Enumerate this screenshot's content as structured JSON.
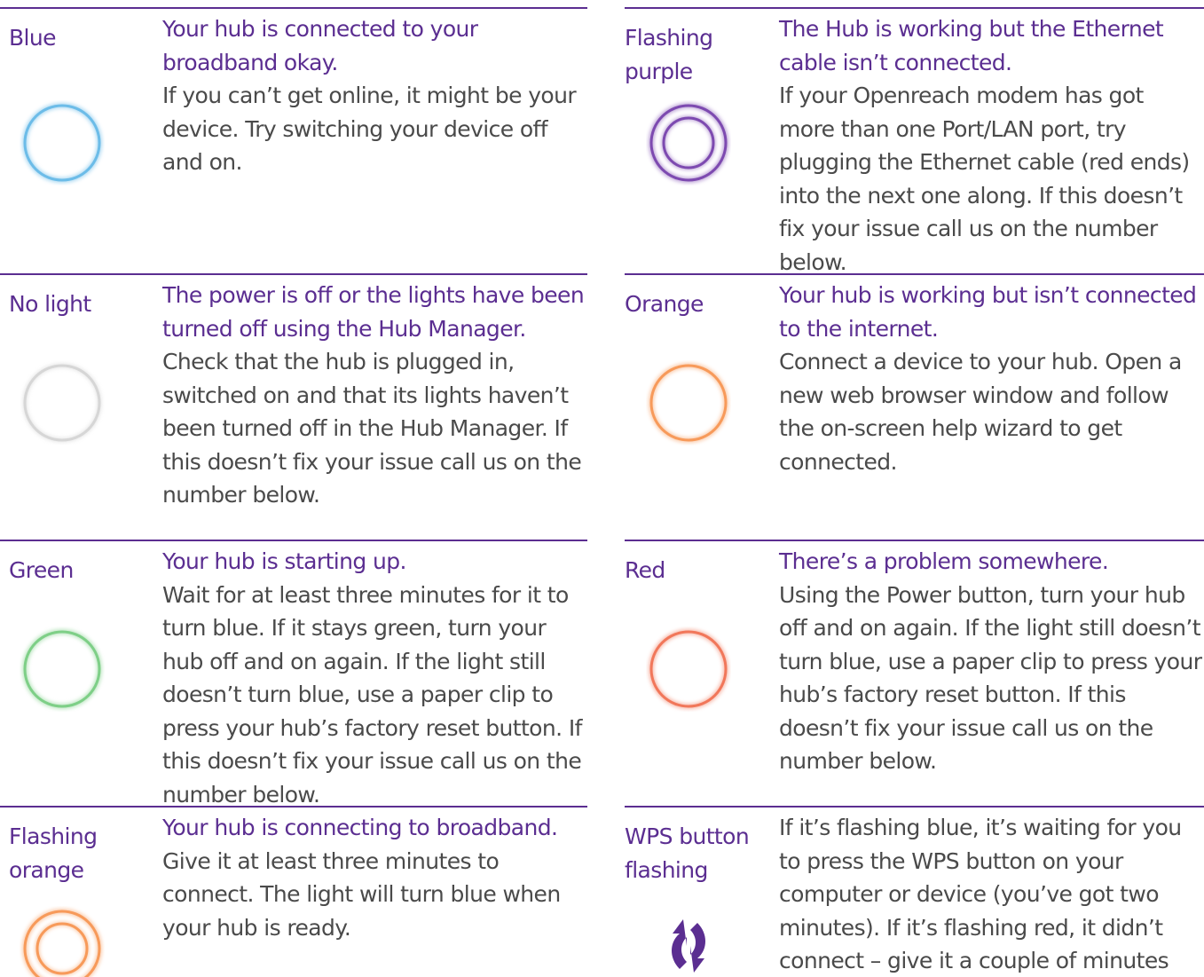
{
  "colors": {
    "brand_purple": "#5b2e91",
    "text_grey": "#4a4a4a",
    "blue": "#6cbce8",
    "grey": "#d6d6d6",
    "green": "#7ecf87",
    "orange": "#f79a5a",
    "purple": "#7d4ab0",
    "red": "#f1775a"
  },
  "left": [
    {
      "label": "Blue",
      "heading": "Your hub is connected to your broadband okay.",
      "body": "If you can’t get online, it might be your device. Try switching your device off and on.",
      "icon": "blue-ring-icon"
    },
    {
      "label": "No light",
      "heading": "The power is off or the lights have been turned off using the Hub Manager.",
      "body": "Check that the hub is plugged in, switched on and that its lights haven’t been turned off in the Hub Manager. If this doesn’t fix your issue call us on the number below.",
      "icon": "grey-ring-icon"
    },
    {
      "label": "Green",
      "heading": "Your hub is starting up.",
      "body": "Wait for at least three minutes for it to turn blue. If it stays green, turn your hub off and on again. If the light still doesn’t turn blue, use a paper clip to press your hub’s factory reset button. If this doesn’t fix your issue call us on the number below.",
      "icon": "green-ring-icon"
    },
    {
      "label": "Flashing orange",
      "heading": "Your hub is connecting to broadband.",
      "body": "Give it at least three minutes to connect. The light will turn blue when your hub is ready.",
      "icon": "flashing-orange-ring-icon"
    }
  ],
  "right": [
    {
      "label": "Flashing purple",
      "heading": "The Hub is working but the Ethernet cable isn’t connected.",
      "body": "If your Openreach modem has got more than one Port/LAN port, try plugging the Ethernet cable (red ends) into the next one along. If this doesn’t fix your issue call us on the number below.",
      "icon": "flashing-purple-ring-icon"
    },
    {
      "label": "Orange",
      "heading": "Your hub is working but isn’t connected to the internet.",
      "body": "Connect a device to your hub. Open a new web browser window and follow the on-screen help wizard to get connected.",
      "icon": "orange-ring-icon"
    },
    {
      "label": "Red",
      "heading": "There’s a problem somewhere.",
      "body": "Using the Power button, turn your hub off and on again. If the light still doesn’t turn blue, use a paper clip to press your hub’s factory reset button. If this doesn’t fix your issue call us on the number below.",
      "icon": "red-ring-icon"
    },
    {
      "label": "WPS button flashing",
      "heading": "",
      "body": "If it’s flashing blue, it’s waiting for you to press the WPS button on your computer or device (you’ve got two minutes). If it’s flashing red, it didn’t connect – give it a couple of minutes and try again.",
      "icon": "wps-icon"
    }
  ]
}
